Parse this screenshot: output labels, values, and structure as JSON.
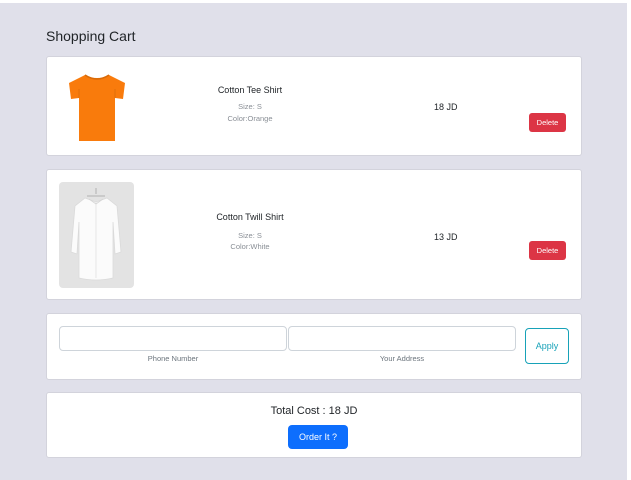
{
  "page": {
    "title": "Shopping Cart"
  },
  "cart": {
    "items": [
      {
        "name": "Cotton Tee Shirt",
        "size": "Size: S",
        "color": "Color:Orange",
        "price": "18 JD",
        "delete_label": "Delete"
      },
      {
        "name": "Cotton Twill Shirt",
        "size": "Size: S",
        "color": "Color:White",
        "price": "13 JD",
        "delete_label": "Delete"
      }
    ]
  },
  "form": {
    "phone_label": "Phone Number",
    "address_label": "Your Address",
    "apply_label": "Apply"
  },
  "summary": {
    "total_text": "Total Cost : 18 JD",
    "order_label": "Order It ?"
  },
  "colors": {
    "background": "#e0e0ea",
    "delete": "#dc3545",
    "primary": "#0d6efd",
    "apply": "#17a2b8",
    "tee": "#f97b0c"
  }
}
